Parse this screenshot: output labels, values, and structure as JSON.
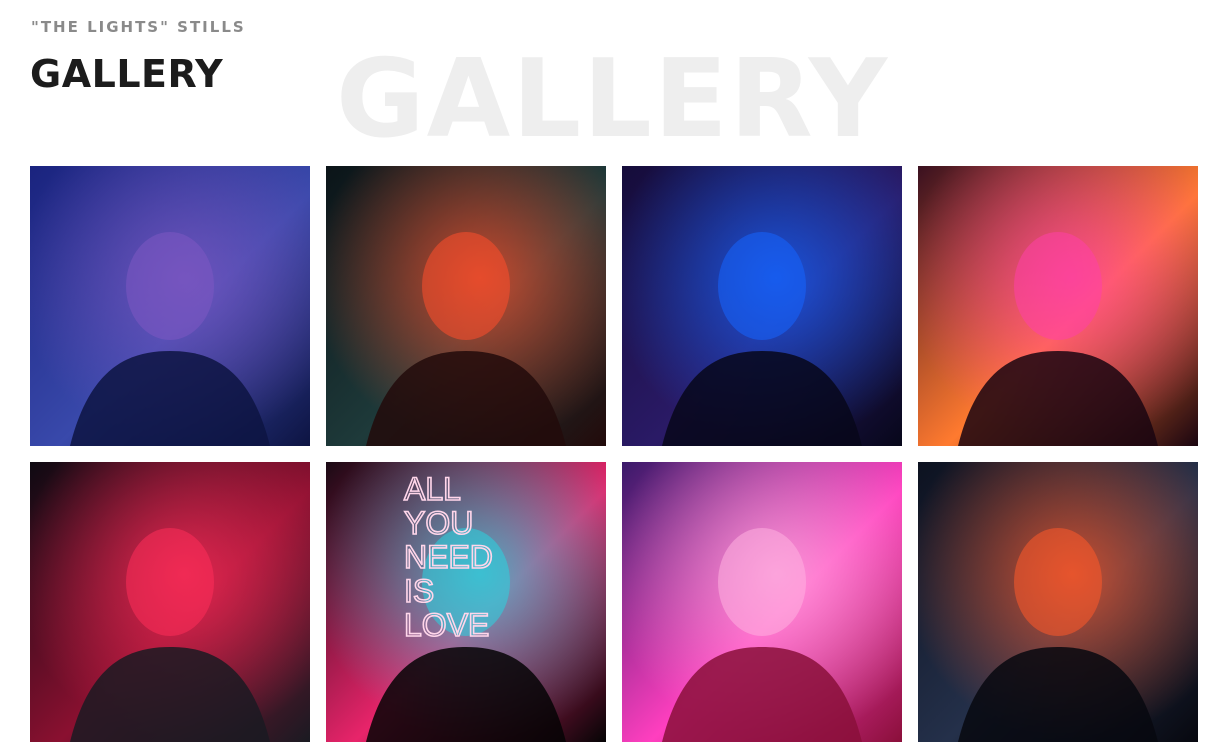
{
  "header": {
    "subtitle": "\"THE LIGHTS\" STILLS",
    "title": "GALLERY",
    "watermark": "GALLERY"
  },
  "gallery": {
    "items": [
      {
        "name": "photo-woman-glasses-blue",
        "palette": [
          "#1a237e",
          "#3949ab",
          "#7e57c2",
          "#0d1442"
        ]
      },
      {
        "name": "photo-woman-beanie-neon",
        "palette": [
          "#0b1418",
          "#1e3a3a",
          "#ff4f2b",
          "#220a0a"
        ]
      },
      {
        "name": "photo-man-sunglasses-jacket",
        "palette": [
          "#150c3a",
          "#2a1a66",
          "#1565ff",
          "#07071a"
        ]
      },
      {
        "name": "photo-woman-neon-sign",
        "palette": [
          "#3a1020",
          "#ff7a2f",
          "#ff3fa8",
          "#1a0510"
        ]
      },
      {
        "name": "photo-woman-red-neon",
        "palette": [
          "#0e0a12",
          "#8a1030",
          "#ff2e5a",
          "#1a1a22"
        ]
      },
      {
        "name": "photo-man-silhouette-all-you-need-sign",
        "palette": [
          "#1a0a14",
          "#e8246a",
          "#2ad4e0",
          "#050405"
        ]
      },
      {
        "name": "photo-woman-light-streaks",
        "palette": [
          "#3a1a6a",
          "#ff3fbf",
          "#ffb0e0",
          "#8a0f3a"
        ]
      },
      {
        "name": "photo-man-fur-hood-neon",
        "palette": [
          "#0d1220",
          "#24304a",
          "#ff5a2a",
          "#07080f"
        ]
      }
    ],
    "signs": {
      "tile5": [
        "ALL",
        "YOU",
        "NEED",
        "IS",
        "LOVE"
      ]
    }
  }
}
